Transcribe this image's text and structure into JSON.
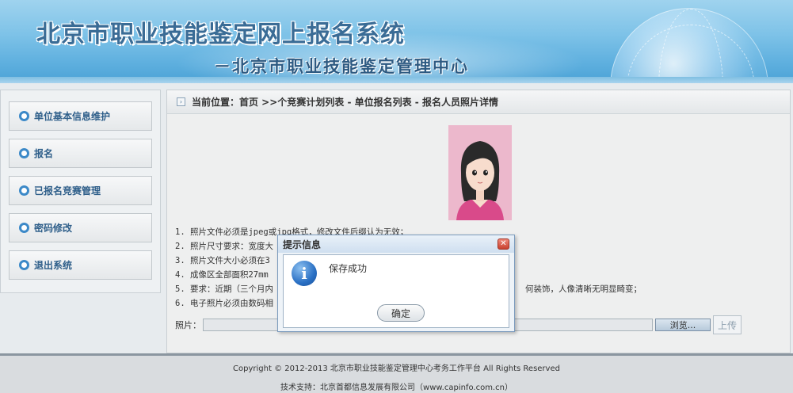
{
  "header": {
    "title": "北京市职业技能鉴定网上报名系统",
    "subtitle": "－北京市职业技能鉴定管理中心"
  },
  "sidebar": {
    "items": [
      {
        "label": "单位基本信息维护"
      },
      {
        "label": "报名"
      },
      {
        "label": "已报名竞赛管理"
      },
      {
        "label": "密码修改"
      },
      {
        "label": "退出系统"
      }
    ]
  },
  "breadcrumb": {
    "text": "当前位置：首页 >>个竞赛计划列表 - 单位报名列表 - 报名人员照片详情"
  },
  "notes": [
    "1. 照片文件必须是jpeg或jpg格式，修改文件后缀认为无效；",
    "2. 照片尺寸要求：宽度大",
    "3. 照片文件大小必须在3",
    "4. 成像区全部面积27mm",
    "5. 要求：近期（三个月内",
    "6. 电子照片必须由数码相"
  ],
  "notes_tail": {
    "line5": "何装饰，人像清晰无明显畸变；"
  },
  "upload": {
    "label": "照片：",
    "browse_label": "浏览...",
    "upload_label": "上传"
  },
  "footer": {
    "copyright": "Copyright © 2012-2013 北京市职业技能鉴定管理中心考务工作平台 All Rights Reserved",
    "support": "技术支持：北京首都信息发展有限公司（www.capinfo.com.cn）"
  },
  "dialog": {
    "title": "提示信息",
    "message": "保存成功",
    "ok_label": "确定",
    "close_glyph": "✕",
    "icon_glyph": "i"
  },
  "colors": {
    "header_blue": "#5fb0df",
    "menu_text": "#2f5f8a",
    "menu_bullet": "#3c89c8",
    "photo_bg": "#ecb8cc"
  }
}
